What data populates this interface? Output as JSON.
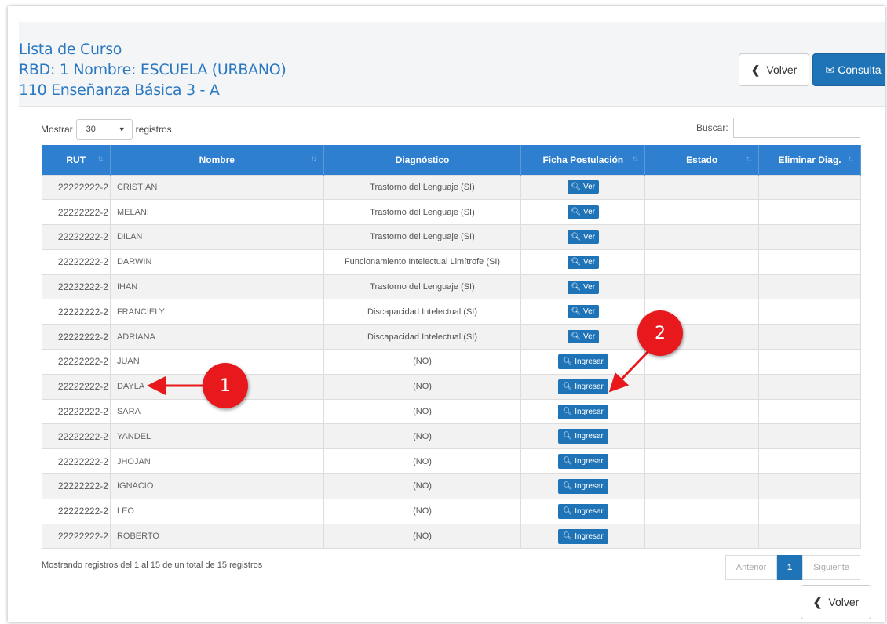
{
  "header": {
    "line1": "Lista de Curso",
    "line2": "RBD: 1   Nombre: ESCUELA  (URBANO)",
    "line3": "110 Enseñanza Básica 3 - A",
    "volver_label": "Volver",
    "consulta_label": "Consulta"
  },
  "controls": {
    "mostrar_label": "Mostrar",
    "page_size": "30",
    "registros_label": "registros",
    "buscar_label": "Buscar:"
  },
  "columns": [
    "RUT",
    "Nombre",
    "Diagnóstico",
    "Ficha Postulación",
    "Estado",
    "Eliminar Diag."
  ],
  "rows": [
    {
      "rut": "22222222-2",
      "nombre": "CRISTIAN",
      "diag": "Trastorno del Lenguaje (SI)",
      "action": "Ver"
    },
    {
      "rut": "22222222-2",
      "nombre": "MELANI",
      "diag": "Trastorno del Lenguaje (SI)",
      "action": "Ver"
    },
    {
      "rut": "22222222-2",
      "nombre": "DILAN",
      "diag": "Trastorno del Lenguaje (SI)",
      "action": "Ver"
    },
    {
      "rut": "22222222-2",
      "nombre": "DARWIN",
      "diag": "Funcionamiento Intelectual Limítrofe (SI)",
      "action": "Ver"
    },
    {
      "rut": "22222222-2",
      "nombre": "IHAN",
      "diag": "Trastorno del Lenguaje (SI)",
      "action": "Ver"
    },
    {
      "rut": "22222222-2",
      "nombre": "FRANCIELY",
      "diag": "Discapacidad Intelectual (SI)",
      "action": "Ver"
    },
    {
      "rut": "22222222-2",
      "nombre": "ADRIANA",
      "diag": "Discapacidad Intelectual (SI)",
      "action": "Ver"
    },
    {
      "rut": "22222222-2",
      "nombre": "JUAN",
      "diag": "(NO)",
      "action": "Ingresar"
    },
    {
      "rut": "22222222-2",
      "nombre": "DAYLA",
      "diag": "(NO)",
      "action": "Ingresar"
    },
    {
      "rut": "22222222-2",
      "nombre": "SARA",
      "diag": "(NO)",
      "action": "Ingresar"
    },
    {
      "rut": "22222222-2",
      "nombre": "YANDEL",
      "diag": "(NO)",
      "action": "Ingresar"
    },
    {
      "rut": "22222222-2",
      "nombre": "JHOJAN",
      "diag": "(NO)",
      "action": "Ingresar"
    },
    {
      "rut": "22222222-2",
      "nombre": "IGNACIO",
      "diag": "(NO)",
      "action": "Ingresar"
    },
    {
      "rut": "22222222-2",
      "nombre": "LEO",
      "diag": "(NO)",
      "action": "Ingresar"
    },
    {
      "rut": "22222222-2",
      "nombre": "ROBERTO",
      "diag": "(NO)",
      "action": "Ingresar"
    }
  ],
  "footer": {
    "info": "Mostrando registros del 1 al 15 de un total de 15 registros",
    "prev_label": "Anterior",
    "page": "1",
    "next_label": "Siguiente",
    "volver_label": "Volver"
  },
  "annotations": {
    "callout1": "1",
    "callout2": "2",
    "color": "#e8191c"
  },
  "icons": {
    "back": "chevron-left-icon",
    "mail": "envelope-icon",
    "search": "search-icon",
    "sort": "sort-icon",
    "dropdown": "chevron-down-icon"
  }
}
